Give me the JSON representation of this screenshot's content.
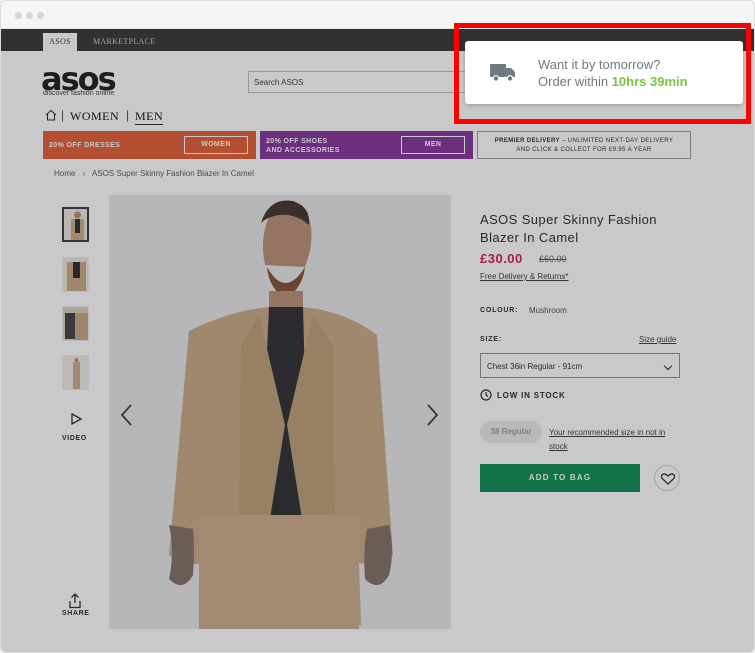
{
  "store": {
    "tabs": [
      {
        "label": "ASOS"
      },
      {
        "label": "MARKETPLACE"
      }
    ],
    "logo": "asos",
    "tagline": "discover fashion online",
    "search_placeholder": "Search ASOS",
    "nav": {
      "women": "WOMEN",
      "men": "MEN"
    }
  },
  "promos": [
    {
      "text": "20% OFF DRESSES",
      "button": "WOMEN",
      "color": "#e4572a"
    },
    {
      "text_line1": "20% OFF SHOES",
      "text_line2": "AND ACCESSORIES",
      "button": "MEN",
      "color": "#7e2a93"
    },
    {
      "bold": "PREMIER DELIVERY",
      "text_line1": " – UNLIMITED NEXT-DAY DELIVERY",
      "text_line2": "AND CLICK & COLLECT FOR £9.95 A YEAR"
    }
  ],
  "breadcrumb": {
    "home": "Home",
    "separator": "›",
    "current": "ASOS Super Skinny Fashion Blazer In Camel"
  },
  "gallery": {
    "video_label": "VIDEO",
    "share_label": "SHARE"
  },
  "product": {
    "title": "ASOS Super Skinny Fashion Blazer In Camel",
    "price": "£30.00",
    "old_price": "£60.00",
    "delivery": "Free Delivery & Returns*",
    "colour_label": "COLOUR:",
    "colour_value": "Mushroom",
    "size_label": "SIZE:",
    "size_guide": "Size guide",
    "size_selected": "Chest 36in Regular - 91cm",
    "stock": "LOW IN STOCK",
    "recommended_badge": "38 Regular",
    "recommended_text": "Your recommended size in not in stock",
    "add_to_bag": "ADD TO BAG",
    "price_color": "#d01345",
    "add_color": "#018849"
  },
  "popup": {
    "line1": "Want it by tomorrow?",
    "line2_prefix": "Order within ",
    "countdown": "10hrs 39min",
    "accent": "#7dc342",
    "highlight": "#ff0000"
  }
}
